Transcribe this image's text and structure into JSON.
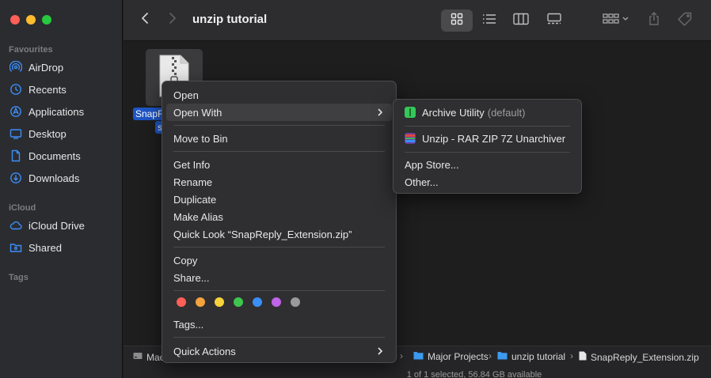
{
  "window": {
    "title": "unzip tutorial"
  },
  "colors": {
    "close": "#fe5f57",
    "minimize": "#febc2e",
    "zoom": "#28c840",
    "accent": "#1e56c6",
    "sidebar_icon": "#3c8ef7"
  },
  "sidebar": {
    "favourites_title": "Favourites",
    "favourites": [
      {
        "label": "AirDrop",
        "icon": "airdrop-icon"
      },
      {
        "label": "Recents",
        "icon": "clock-icon"
      },
      {
        "label": "Applications",
        "icon": "applications-icon"
      },
      {
        "label": "Desktop",
        "icon": "desktop-icon"
      },
      {
        "label": "Documents",
        "icon": "document-icon"
      },
      {
        "label": "Downloads",
        "icon": "download-icon"
      }
    ],
    "icloud_title": "iCloud",
    "icloud": [
      {
        "label": "iCloud Drive",
        "icon": "cloud-icon"
      },
      {
        "label": "Shared",
        "icon": "shared-folder-icon"
      }
    ],
    "tags_title": "Tags"
  },
  "file": {
    "label_line1": "SnapR",
    "label_line2": "s"
  },
  "context_menu": {
    "open": "Open",
    "open_with": "Open With",
    "move_to_bin": "Move to Bin",
    "get_info": "Get Info",
    "rename": "Rename",
    "duplicate": "Duplicate",
    "make_alias": "Make Alias",
    "quick_look": "Quick Look “SnapReply_Extension.zip”",
    "copy": "Copy",
    "share": "Share...",
    "tags": "Tags...",
    "quick_actions": "Quick Actions",
    "tag_colors": [
      "#fe5f57",
      "#f5a33c",
      "#f6d33b",
      "#3fc64f",
      "#3b8ff6",
      "#c064e8",
      "#9a9a9c"
    ]
  },
  "submenu": {
    "archive_utility": "Archive Utility",
    "archive_default": "(default)",
    "unzip_app": "Unzip - RAR ZIP 7Z Unarchiver",
    "app_store": "App Store...",
    "other": "Other..."
  },
  "pathbar": {
    "items": [
      "Mac",
      "Major Projects",
      "unzip tutorial",
      "SnapReply_Extension.zip"
    ]
  },
  "status": {
    "text": "1 of 1 selected, 56.84 GB available"
  }
}
